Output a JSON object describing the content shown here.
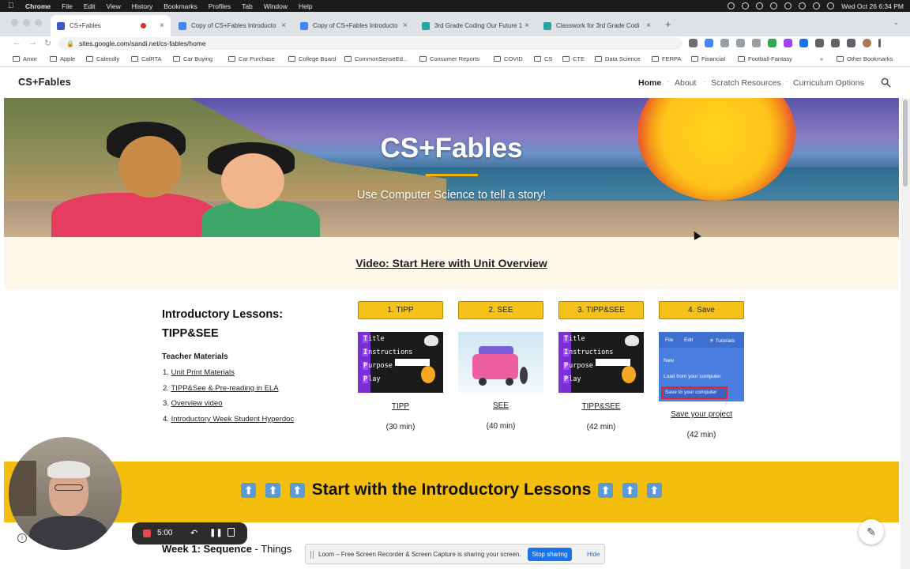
{
  "menubar": {
    "app": "Chrome",
    "items": [
      "File",
      "Edit",
      "View",
      "History",
      "Bookmarks",
      "Profiles",
      "Tab",
      "Window",
      "Help"
    ],
    "clock": "Wed Oct 26  6:34 PM"
  },
  "tabs": [
    {
      "title": "CS+Fables",
      "favicon_color": "#3c58c9"
    },
    {
      "title": "Copy of CS+Fables Introducto",
      "favicon_color": "#4285f4"
    },
    {
      "title": "Copy of CS+Fables Introducto",
      "favicon_color": "#4285f4"
    },
    {
      "title": "3rd Grade Coding Our Future 1",
      "favicon_color": "#22a7a0"
    },
    {
      "title": "Classwork for 3rd Grade Codi",
      "favicon_color": "#22a7a0"
    }
  ],
  "newtab_label": "+",
  "address": "sites.google.com/sandi.net/cs-fables/home",
  "bookmarks": [
    "Amor",
    "Apple",
    "Calendly",
    "CalRTA",
    "Car Buying",
    "Car Purchase",
    "College Board",
    "CommonSenseEd...",
    "Consumer Reports",
    "COVID",
    "CS",
    "CTE",
    "Data Science",
    "FERPA",
    "Financial",
    "Football-Fantasy"
  ],
  "bookmarks_more": "»",
  "bookmarks_other": "Other Bookmarks",
  "site": {
    "title": "CS+Fables",
    "nav": [
      "Home",
      "About",
      "Scratch Resources",
      "Curriculum Options"
    ]
  },
  "hero": {
    "title": "CS+Fables",
    "subtitle": "Use Computer Science to tell a story!"
  },
  "video_link": "Video: Start Here with Unit Overview",
  "intro": {
    "title": "Introductory Lessons: TIPP&SEE",
    "teacher_materials_heading": "Teacher Materials",
    "materials": [
      {
        "num": "1.",
        "label": "Unit Print Materials"
      },
      {
        "num": "2.",
        "label": "TIPP&See & Pre-reading in ELA"
      },
      {
        "num": "3.",
        "label": "Overview video"
      },
      {
        "num": "4.",
        "label": "Introductory Week Student Hyperdoc"
      }
    ],
    "lessons": [
      {
        "button": "1. TIPP",
        "link": "TIPP",
        "duration": "(30 min)"
      },
      {
        "button": "2. SEE",
        "link": "SEE",
        "duration": "(40 min)"
      },
      {
        "button": "3. TIPP&SEE",
        "link": "TIPP&SEE",
        "duration": "(42 min)"
      },
      {
        "button": "4. Save",
        "link": "Save your project",
        "duration": "(42 min)"
      }
    ],
    "tipp_thumb_lines": [
      {
        "letter": "T",
        "rest": "itle"
      },
      {
        "letter": "I",
        "rest": "nstructions"
      },
      {
        "letter": "P",
        "rest": "urpose"
      },
      {
        "letter": "P",
        "rest": "lay"
      }
    ],
    "save_thumb": {
      "menu": [
        "File",
        "Edit",
        "Tutorials"
      ],
      "items": [
        "New",
        "Load from your computer",
        "Save to your computer"
      ]
    }
  },
  "start_banner": "Start with the Introductory Lessons",
  "start_arrow": "⬆",
  "week1": {
    "bold": "Week 1: Sequence",
    "rest": " - Things"
  },
  "loom": {
    "message": "Loom – Free Screen Recorder & Screen Capture is sharing your screen.",
    "stop": "Stop sharing",
    "hide": "Hide"
  },
  "recorder": {
    "time": "5:00"
  }
}
